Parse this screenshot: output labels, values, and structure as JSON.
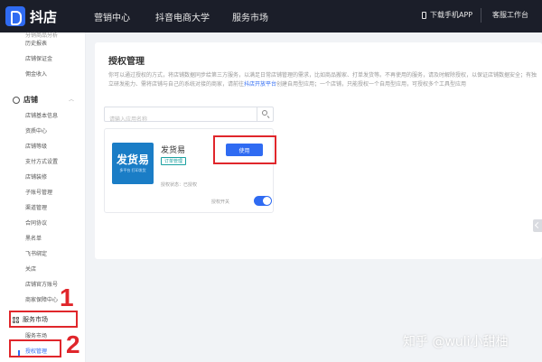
{
  "brand": {
    "name": "抖店"
  },
  "topnav": {
    "items": [
      "营销中心",
      "抖音电商大学",
      "服务市场"
    ],
    "download_app": "下载手机APP",
    "service_desk": "客服工作台"
  },
  "sidebar": {
    "cut_item": "分销商品分析",
    "finance_items": [
      "历史报表",
      "店铺保证金",
      "佣金收入"
    ],
    "store_section": "店铺",
    "store_items": [
      "店铺基本信息",
      "资质中心",
      "店铺等级",
      "支付方式设置",
      "店铺装修",
      "子账号管理",
      "渠道管理",
      "合同协议",
      "黑名单",
      "飞书绑定",
      "关店",
      "店铺官方账号",
      "商家保障中心"
    ],
    "service_section": "服务市场",
    "service_items": [
      "服务市场",
      "授权管理"
    ]
  },
  "annotations": {
    "one": "1",
    "two": "2"
  },
  "panel": {
    "title": "授权管理",
    "desc_part1": "你可以通过授权的方式，将店铺数据同步给第三方服务，以满足日常店铺管理的需求，比如商品搬家、打单发货等。不再使用的服务，请及时解除授权，以保证店铺数据安全；有独立研发能力、需将店铺与自己的系统对接的商家，请前往",
    "desc_link": "抖店开放平台",
    "desc_part2": "创建自用型应用；一个店铺，只能授权一个自用型应用，可授权多个工具型应用"
  },
  "search": {
    "placeholder": "请输入应用名称"
  },
  "app_card": {
    "logo_main": "发货易",
    "logo_sub": "多平台 打印发货",
    "name": "发货易",
    "tag": "订单管理",
    "use_label": "使用",
    "status": "授权状态：已授权",
    "toggle_label": "授权开关",
    "toggle_on": true
  },
  "watermark": "知乎 @wuli小甜柚",
  "colors": {
    "accent": "#2f6bf2",
    "topbar": "#1b1e29",
    "annotation": "#e0262b",
    "app_logo": "#1a7dc6"
  }
}
